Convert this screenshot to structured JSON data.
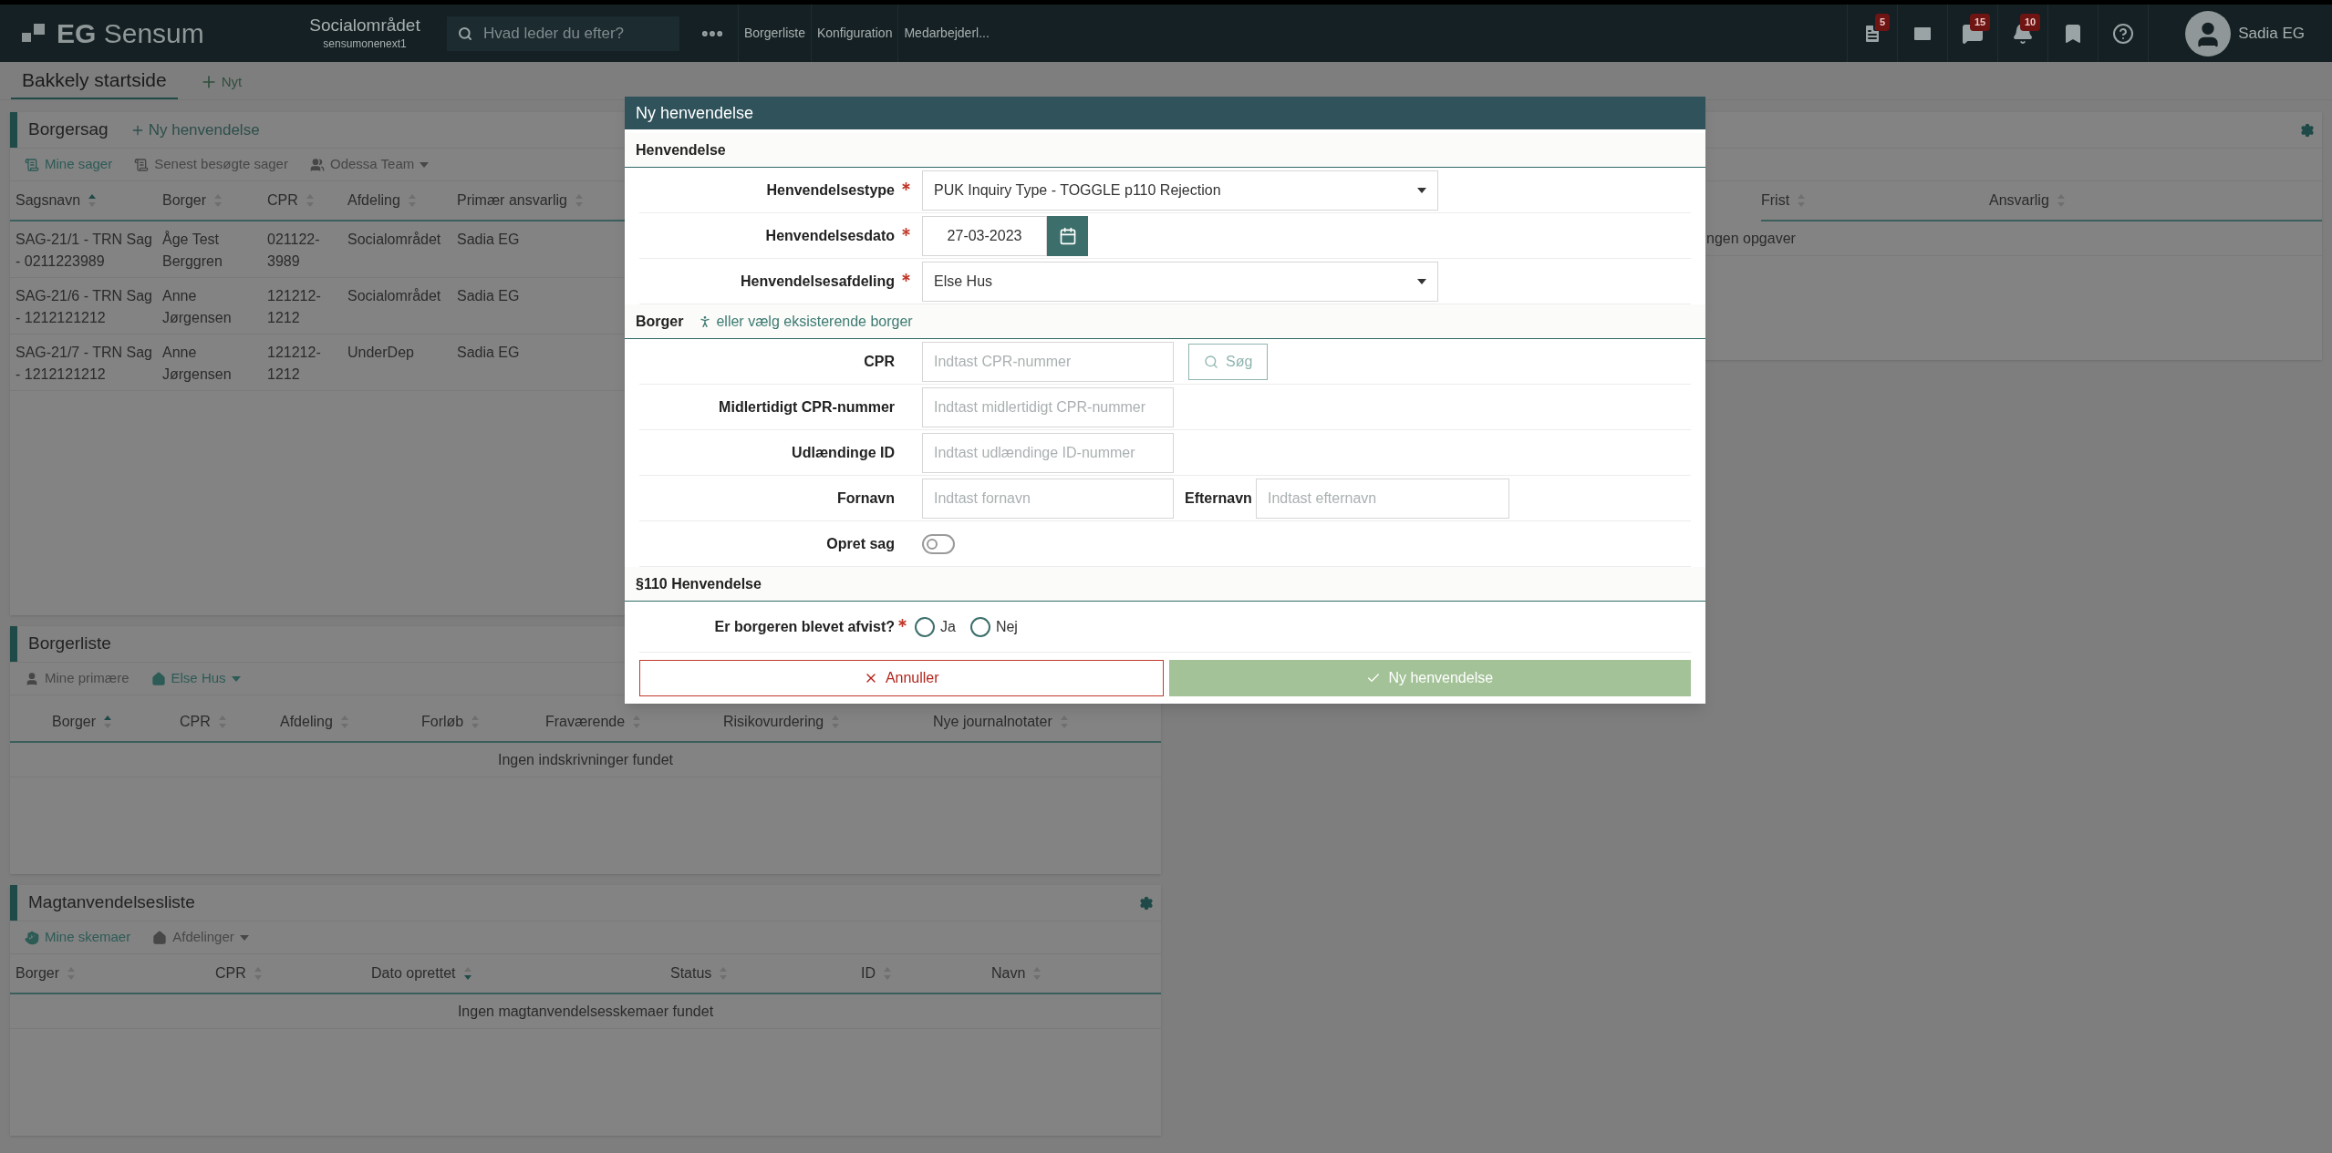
{
  "topbar": {
    "logo": "**EG** Sensum",
    "org": "Socialområdet",
    "server": "sensumonenext1",
    "search": {
      "placeholder": "Hvad leder du efter?"
    },
    "nav_links": [
      "Borgerliste",
      "Konfiguration",
      "Medarbejderl..."
    ],
    "icons": [
      {
        "kind": "document",
        "badge": "5"
      },
      {
        "kind": "mail"
      },
      {
        "kind": "chat",
        "badge": "15"
      },
      {
        "kind": "bell",
        "badge": "10"
      },
      {
        "kind": "bookmark"
      },
      {
        "kind": "help"
      }
    ],
    "user": "Sadia EG"
  },
  "page_tabs": [
    {
      "label": "Bakkely startside",
      "selected": true
    }
  ],
  "new_tab": "Nyt",
  "borgersag": {
    "title": "Borgersag",
    "action": "Ny henvendelse",
    "filters": [
      {
        "kind": "cases",
        "label": "Mine sager",
        "selected": true
      },
      {
        "kind": "cases",
        "label": "Senest besøgte sager",
        "selected": false
      },
      {
        "kind": "team",
        "label": "Odessa Team",
        "selected": false,
        "dropdown": true
      }
    ],
    "columns": [
      {
        "label": "Sagsnavn",
        "sorted": true
      },
      {
        "label": "Borger",
        "sorted": false
      },
      {
        "label": "CPR",
        "sorted": false
      },
      {
        "label": "Afdeling",
        "sorted": false
      },
      {
        "label": "Primær ansvarlig",
        "sorted": false
      }
    ],
    "rows": [
      [
        "SAG-21/1 - TRN Sag - 0211223989",
        "Åge Test Berggren",
        "021122-3989",
        "Socialområdet",
        "Sadia EG"
      ],
      [
        "SAG-21/6 - TRN Sag - 1212121212",
        "Anne Jørgensen",
        "121212-1212",
        "Socialområdet",
        "Sadia EG"
      ],
      [
        "SAG-21/7 - TRN Sag - 1212121212",
        "Anne Jørgensen",
        "121212-1212",
        "UnderDep",
        "Sadia EG"
      ]
    ]
  },
  "opgaver": {
    "columns": [
      {
        "label": "Frist",
        "sorted": false
      },
      {
        "label": "Ansvarlig",
        "sorted": false
      }
    ],
    "empty": "ngen opgaver"
  },
  "borgerliste": {
    "title": "Borgerliste",
    "filters": [
      {
        "kind": "person",
        "label": "Mine primære",
        "selected": false
      },
      {
        "kind": "home",
        "label": "Else Hus",
        "selected": true,
        "dropdown": true
      }
    ],
    "columns": [
      {
        "label": "Borger",
        "sorted": true
      },
      {
        "label": "CPR",
        "sorted": false
      },
      {
        "label": "Afdeling",
        "sorted": false
      },
      {
        "label": "Forløb",
        "sorted": false
      },
      {
        "label": "Fraværende",
        "sorted": false
      },
      {
        "label": "Risikovurdering",
        "sorted": false
      },
      {
        "label": "Nye journalnotater",
        "sorted": false
      }
    ],
    "empty": "Ingen indskrivninger fundet"
  },
  "magt": {
    "title": "Magtanvendelsesliste",
    "filters": [
      {
        "kind": "hand",
        "label": "Mine skemaer",
        "selected": true
      },
      {
        "kind": "home",
        "label": "Afdelinger",
        "selected": false,
        "dropdown": true
      }
    ],
    "columns": [
      {
        "label": "Borger",
        "sorted": false
      },
      {
        "label": "CPR",
        "sorted": false
      },
      {
        "label": "Dato oprettet",
        "sorted": true,
        "descending": true
      },
      {
        "label": "Status",
        "sorted": false
      },
      {
        "label": "ID",
        "sorted": false
      },
      {
        "label": "Navn",
        "sorted": false
      }
    ],
    "empty": "Ingen magtanvendelsesskemaer fundet"
  },
  "modal": {
    "title": "Ny henvendelse",
    "section1": {
      "title": "Henvendelse",
      "fields": [
        {
          "kind": "select",
          "label": "Henvendelsestype",
          "required": true,
          "value": "PUK Inquiry Type - TOGGLE p110 Rejection"
        },
        {
          "kind": "date",
          "label": "Henvendelsesdato",
          "required": true,
          "value": "27-03-2023"
        },
        {
          "kind": "select",
          "label": "Henvendelsesafdeling",
          "required": true,
          "value": "Else Hus"
        }
      ]
    },
    "section2": {
      "title": "Borger",
      "link": "eller vælg eksisterende borger",
      "fields": [
        {
          "kind": "search",
          "label": "CPR",
          "placeholder": "Indtast CPR-nummer",
          "button": "Søg"
        },
        {
          "kind": "text",
          "label": "Midlertidigt CPR-nummer",
          "placeholder": "Indtast midlertidigt CPR-nummer"
        },
        {
          "kind": "text",
          "label": "Udlændinge ID",
          "placeholder": "Indtast udlændinge ID-nummer"
        },
        {
          "kind": "pair",
          "label": "Fornavn",
          "placeholder": "Indtast fornavn",
          "label2": "Efternavn",
          "placeholder2": "Indtast efternavn"
        },
        {
          "kind": "toggle",
          "label": "Opret sag",
          "on": false
        }
      ]
    },
    "section3": {
      "title": "§110 Henvendelse",
      "question": "Er borgeren blevet afvist?",
      "required": true,
      "options": [
        {
          "label": "Ja",
          "selected": false
        },
        {
          "label": "Nej",
          "selected": false
        }
      ]
    },
    "cancel": "Annuller",
    "submit": "Ny henvendelse"
  }
}
